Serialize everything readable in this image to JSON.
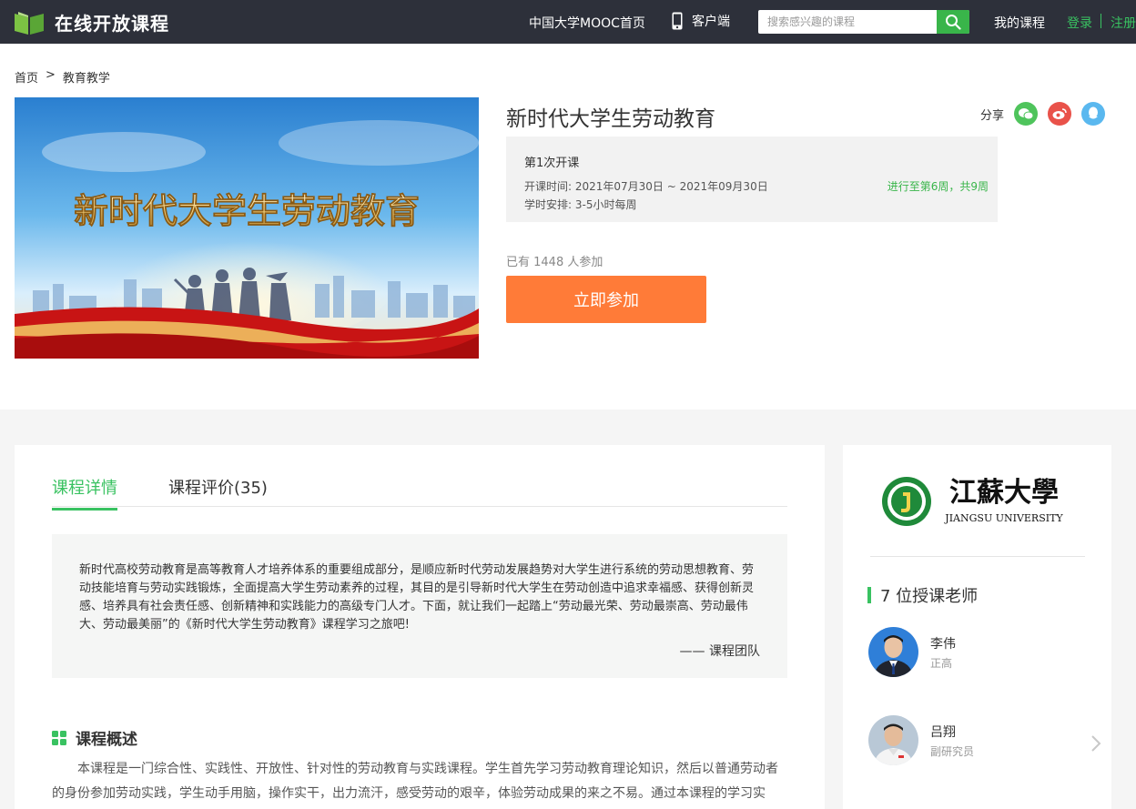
{
  "topbar": {
    "logo_text": "在线开放课程",
    "mooc_home": "中国大学MOOC首页",
    "app_label": "客户端",
    "search_placeholder": "搜索感兴趣的课程",
    "my_courses": "我的课程",
    "login": "登录",
    "register": "注册"
  },
  "breadcrumb": {
    "home": "首页",
    "separator": ">",
    "category": "教育教学"
  },
  "course": {
    "title": "新时代大学生劳动教育",
    "cover_text": "新时代大学生劳动教育",
    "share_label": "分享",
    "term_name": "第1次开课",
    "term_time": "开课时间:  2021年07月30日 ~ 2021年09月30日",
    "term_hours": "学时安排:  3-5小时每周",
    "term_progress": "进行至第6周，共9周",
    "enroll_count": "已有 1448 人参加",
    "join_button": "立即参加"
  },
  "tabs": {
    "detail": "课程详情",
    "review": "课程评价(35)"
  },
  "intro": {
    "text": "新时代高校劳动教育是高等教育人才培养体系的重要组成部分，是顺应新时代劳动发展趋势对大学生进行系统的劳动思想教育、劳动技能培育与劳动实践锻炼，全面提高大学生劳动素养的过程，其目的是引导新时代大学生在劳动创造中追求幸福感、获得创新灵感、培养具有社会责任感、创新精神和实践能力的高级专门人才。下面，就让我们一起踏上“劳动最光荣、劳动最崇高、劳动最伟大、劳动最美丽”的《新时代大学生劳动教育》课程学习之旅吧!",
    "signature": "—— 课程团队"
  },
  "overview": {
    "title": "课程概述",
    "text": "本课程是一门综合性、实践性、开放性、针对性的劳动教育与实践课程。学生首先学习劳动教育理论知识，然后以普通劳动者的身份参加劳动实践，学生动手用脑，操作实干，出力流汗，感受劳动的艰辛，体验劳动成果的来之不易。通过本课程的学习实"
  },
  "sidebar": {
    "school_name_cn": "江蘇大學",
    "school_name_en": "JIANGSU UNIVERSITY",
    "teacher_heading": "7 位授课老师",
    "teachers": [
      {
        "name": "李伟",
        "title": "正高"
      },
      {
        "name": "吕翔",
        "title": "副研究员"
      }
    ]
  },
  "colors": {
    "accent_green": "#39c261",
    "join_orange": "#ff7b38",
    "topbar": "#2d303a"
  }
}
